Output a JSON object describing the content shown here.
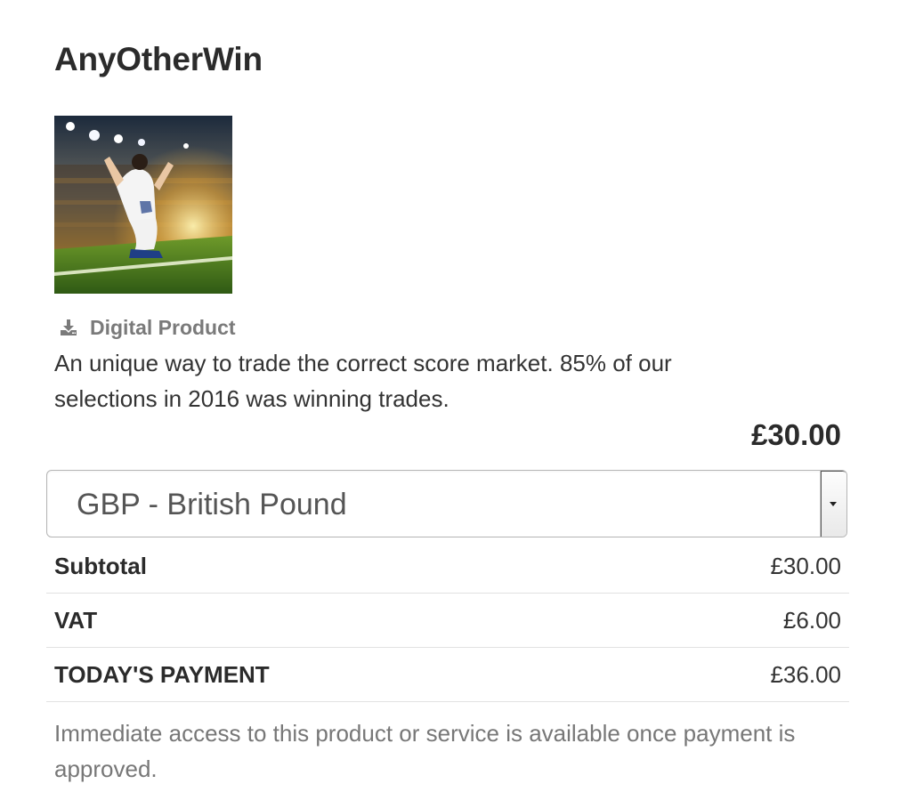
{
  "product": {
    "name": "AnyOtherWin",
    "image_alt": "Football player celebrating on knees in stadium",
    "type_label": "Digital Product",
    "type_icon": "download-icon",
    "description": "An unique way to trade the correct score market. 85% of our selections in 2016 was winning trades.",
    "price": "£30.00"
  },
  "currency": {
    "selected": "GBP - British Pound",
    "arrow_icon": "caret-down-icon"
  },
  "summary": {
    "rows": [
      {
        "label": "Subtotal",
        "amount": "£30.00"
      },
      {
        "label": "VAT",
        "amount": "£6.00"
      },
      {
        "label": "TODAY'S PAYMENT",
        "amount": "£36.00"
      }
    ]
  },
  "notice": "Immediate access to this product or service is available once payment is approved.",
  "colors": {
    "heading": "#2b2b2b",
    "muted": "#777777",
    "border": "#e2e2e2"
  }
}
